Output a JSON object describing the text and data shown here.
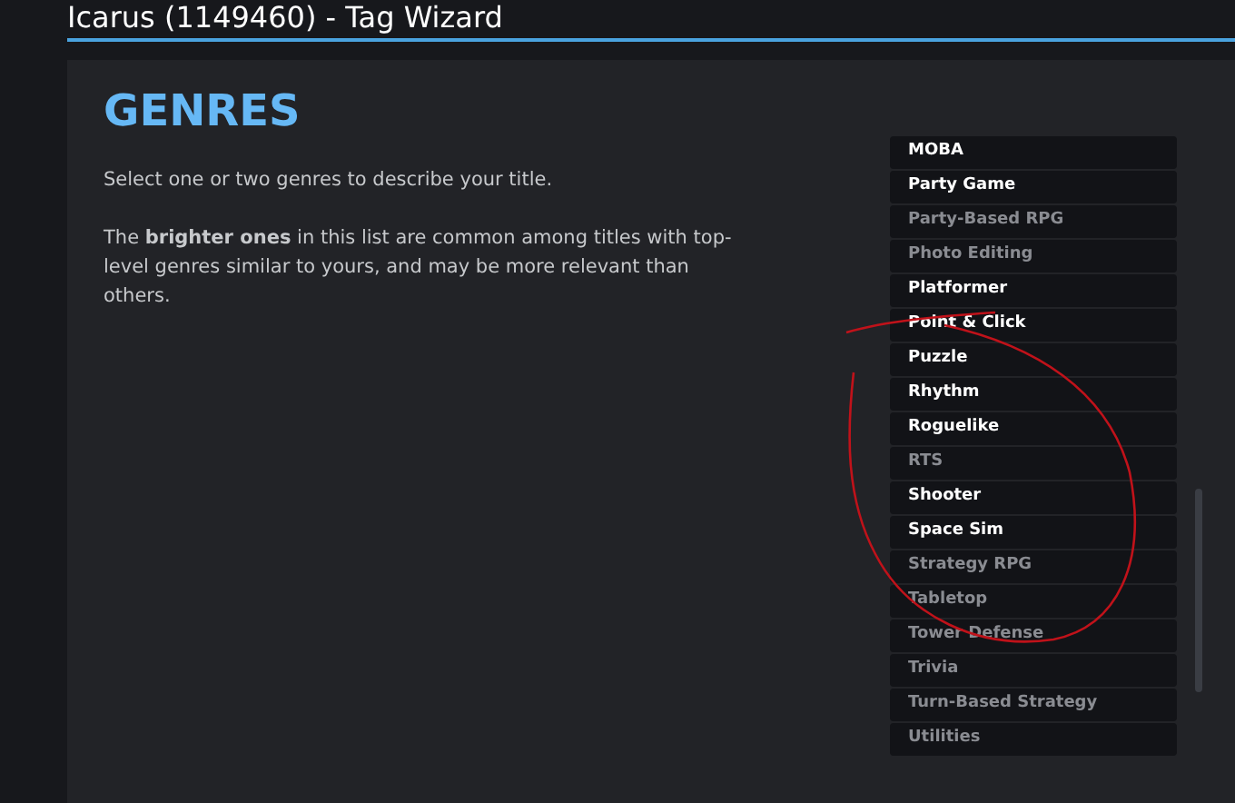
{
  "window": {
    "title": "Icarus (1149460) - Tag Wizard"
  },
  "heading": "GENRES",
  "paragraphs": [
    "Select one or two genres to describe your title.",
    "The **brighter ones** in this list are common among titles with top-level genres similar to yours, and may be more relevant than others."
  ],
  "genres": [
    {
      "label": "MOBA",
      "bright": true
    },
    {
      "label": "Party Game",
      "bright": true
    },
    {
      "label": "Party-Based RPG",
      "bright": false
    },
    {
      "label": "Photo Editing",
      "bright": false
    },
    {
      "label": "Platformer",
      "bright": true
    },
    {
      "label": "Point & Click",
      "bright": true
    },
    {
      "label": "Puzzle",
      "bright": true
    },
    {
      "label": "Rhythm",
      "bright": true
    },
    {
      "label": "Roguelike",
      "bright": true
    },
    {
      "label": "RTS",
      "bright": false
    },
    {
      "label": "Shooter",
      "bright": true
    },
    {
      "label": "Space Sim",
      "bright": true
    },
    {
      "label": "Strategy RPG",
      "bright": false
    },
    {
      "label": "Tabletop",
      "bright": false
    },
    {
      "label": "Tower Defense",
      "bright": false
    },
    {
      "label": "Trivia",
      "bright": false
    },
    {
      "label": "Turn-Based Strategy",
      "bright": false
    },
    {
      "label": "Utilities",
      "bright": false
    }
  ]
}
